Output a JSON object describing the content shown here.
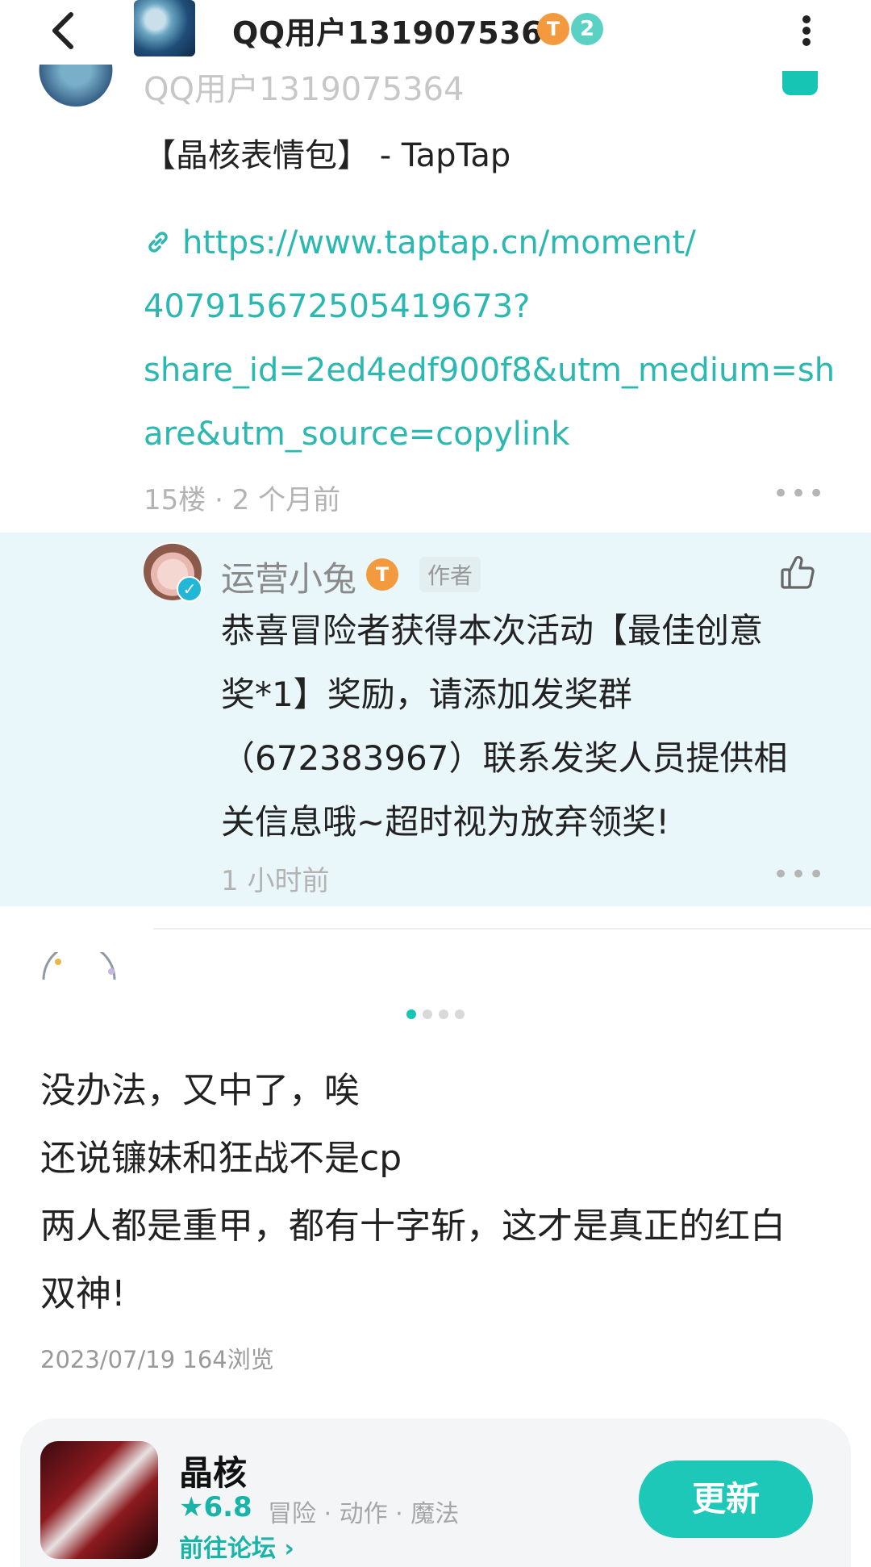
{
  "header": {
    "user_name": "QQ用户1319075364",
    "badge_t": "T",
    "badge_level": "2",
    "icons": {
      "back": "back-arrow-icon",
      "more": "more-vertical-icon"
    }
  },
  "comment": {
    "faded_name": "QQ用户1319075364",
    "title": "【晶核表情包】 - TapTap",
    "link_icon": "link-icon",
    "link_lines": [
      "https://www.taptap.cn/moment/",
      "407915672505419673?",
      "share_id=2ed4edf900f8&utm_medium=sh",
      "are&utm_source=copylink"
    ],
    "meta": "15楼 · 2 个月前",
    "more": "•••"
  },
  "reply": {
    "name": "运营小兔",
    "badge_t": "T",
    "author_tag": "作者",
    "text_lines": [
      "恭喜冒险者获得本次活动【最佳创意",
      "奖*1】奖励，请添加发奖群",
      "（672383967）联系发奖人员提供相",
      "关信息哦~超时视为放弃领奖!"
    ],
    "meta": "1 小时前",
    "more": "•••"
  },
  "carousel": {
    "count": 4,
    "active": 0
  },
  "post": {
    "lines": [
      "没办法，又中了，唉",
      "还说镰妹和狂战不是cp",
      "两人都是重甲，都有十字斩，这才是真正的红白",
      "双神!"
    ],
    "date": "2023/07/19",
    "views": "164浏览"
  },
  "game": {
    "name": "晶核",
    "rating": "★6.8",
    "tags": "冒险 · 动作 · 魔法",
    "forum_link": "前往论坛 ›",
    "update_button": "更新"
  },
  "colors": {
    "accent": "#1ec8b8",
    "link": "#2ab8b1",
    "reply_bg": "#eaf7fa",
    "badge_orange": "#f39a3e"
  }
}
